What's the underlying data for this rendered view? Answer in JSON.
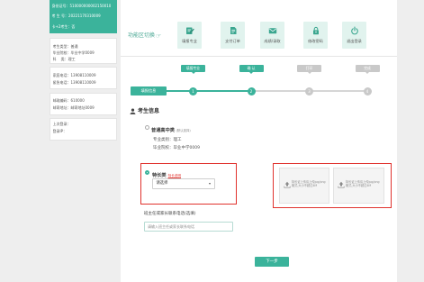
{
  "colors": {
    "accent": "#3bb39b",
    "highlight": "#e0322d",
    "inactive": "#c9c9c9"
  },
  "sidebar": {
    "profile": [
      {
        "label": "身份证号：",
        "value": "510000000002150010"
      },
      {
        "label": "考 生 号：",
        "value": "20221170310009"
      },
      {
        "label": "卡+2考生：",
        "value": "否"
      }
    ],
    "cards": [
      [
        {
          "label": "考生类型：",
          "value": "普通"
        },
        {
          "label": "毕业院校：",
          "value": "毕业中学0009"
        },
        {
          "label": "科    类：",
          "value": "理工"
        }
      ],
      [
        {
          "label": "家庭电话：",
          "value": "13908110009"
        },
        {
          "label": "紧急电话：",
          "value": "13908110009"
        }
      ],
      [
        {
          "label": "邮政编码：",
          "value": "610000"
        },
        {
          "label": "邮寄地址：",
          "value": "邮寄地址0009"
        }
      ],
      [
        {
          "label": "上次登录："
        },
        {
          "label": "登录IP："
        }
      ]
    ]
  },
  "header": {
    "title": "功能区切换",
    "title_icon": "pointing-hand-icon"
  },
  "nav_tiles": [
    {
      "label": "填报专业",
      "icon": "edit-icon"
    },
    {
      "label": "支付订单",
      "icon": "document-icon"
    },
    {
      "label": "成绩/录取",
      "icon": "envelope-icon"
    },
    {
      "label": "修改密码",
      "icon": "lock-icon"
    },
    {
      "label": "退出登录",
      "icon": "power-icon"
    }
  ],
  "steps": {
    "tab_label": "填报信息",
    "items": [
      {
        "label": "填报专业",
        "number": "1",
        "active": true
      },
      {
        "label": "确 认",
        "number": "2",
        "active": true
      },
      {
        "label": "打印",
        "number": "3",
        "active": false
      },
      {
        "label": "完成",
        "number": "4",
        "active": false
      }
    ]
  },
  "section": {
    "title": "考生信息",
    "icon": "user-icon"
  },
  "options": {
    "regular": {
      "label": "普通高中类",
      "note": "(默认选择)",
      "checked": false,
      "fields": [
        {
          "label": "专业类别：",
          "value": "理工"
        },
        {
          "label": "毕业院校：",
          "value": "毕业中学0009"
        }
      ]
    },
    "specialty": {
      "label": "特长类",
      "link": "特长说明",
      "checked": true,
      "select": {
        "value": "请选择"
      }
    }
  },
  "uploads": [
    {
      "text": "特长证上传请上传jpg/png格式,大小不超过4M",
      "icon": "upload-icon"
    },
    {
      "text": "特长证上传请上传jpg/png格式,大小不超过4M",
      "icon": "upload-icon"
    }
  ],
  "contact": {
    "label": "班主任或家长联系电话(选填)",
    "placeholder": "请输入班主任或家长联系电话",
    "value": ""
  },
  "actions": {
    "next_label": "下一步"
  }
}
